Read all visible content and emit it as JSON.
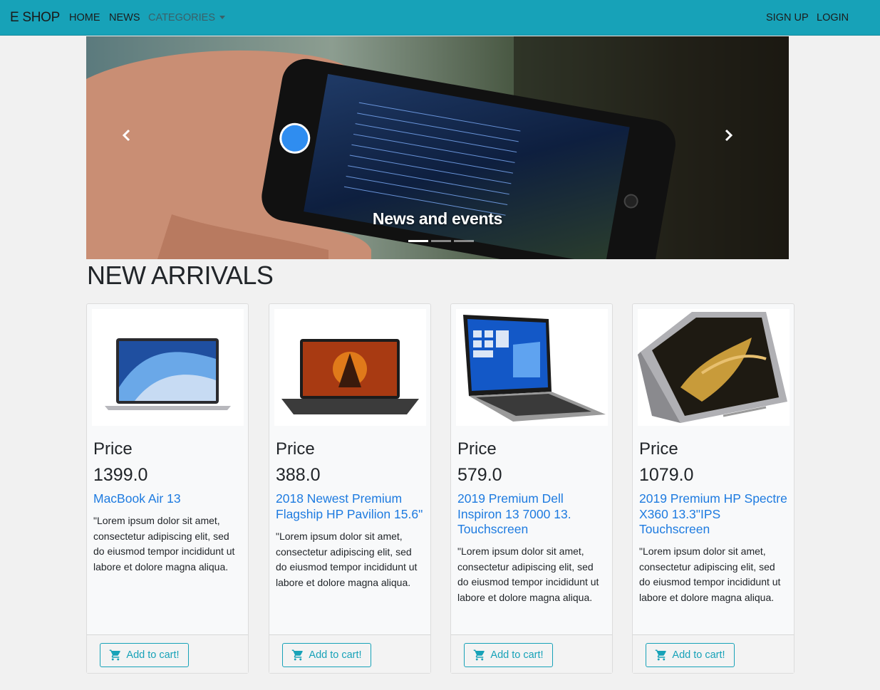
{
  "navbar": {
    "brand": "E SHOP",
    "links": {
      "home": "HOME",
      "news": "NEWS",
      "categories": "CATEGORIES"
    },
    "auth": {
      "signup": "SIGN UP",
      "login": "LOGIN"
    }
  },
  "carousel": {
    "caption": "News and events",
    "slide_count": 3,
    "active_slide": 1,
    "prev_icon": "chevron-left-icon",
    "next_icon": "chevron-right-icon"
  },
  "section_title": "NEW ARRIVALS",
  "products": [
    {
      "price_label": "Price",
      "price": "1399.0",
      "title": "MacBook Air 13",
      "description": "\"Lorem ipsum dolor sit amet, consectetur adipiscing elit, sed do eiusmod tempor incididunt ut labore et dolore magna aliqua.",
      "button": "Add to cart!"
    },
    {
      "price_label": "Price",
      "price": "388.0",
      "title": "2018 Newest Premium Flagship HP Pavilion 15.6\"",
      "description": "\"Lorem ipsum dolor sit amet, consectetur adipiscing elit, sed do eiusmod tempor incididunt ut labore et dolore magna aliqua.",
      "button": "Add to cart!"
    },
    {
      "price_label": "Price",
      "price": "579.0",
      "title": "2019 Premium Dell Inspiron 13 7000 13. Touchscreen",
      "description": "\"Lorem ipsum dolor sit amet, consectetur adipiscing elit, sed do eiusmod tempor incididunt ut labore et dolore magna aliqua.",
      "button": "Add to cart!"
    },
    {
      "price_label": "Price",
      "price": "1079.0",
      "title": "2019 Premium HP Spectre X360 13.3\"IPS Touchscreen",
      "description": "\"Lorem ipsum dolor sit amet, consectetur adipiscing elit, sed do eiusmod tempor incididunt ut labore et dolore magna aliqua.",
      "button": "Add to cart!"
    }
  ],
  "colors": {
    "navbar": "#17a2b8",
    "link": "#1e7be0",
    "button": "#17a2b8",
    "background": "#f1f1f1"
  },
  "icons": {
    "cart": "shopping-cart-icon"
  }
}
